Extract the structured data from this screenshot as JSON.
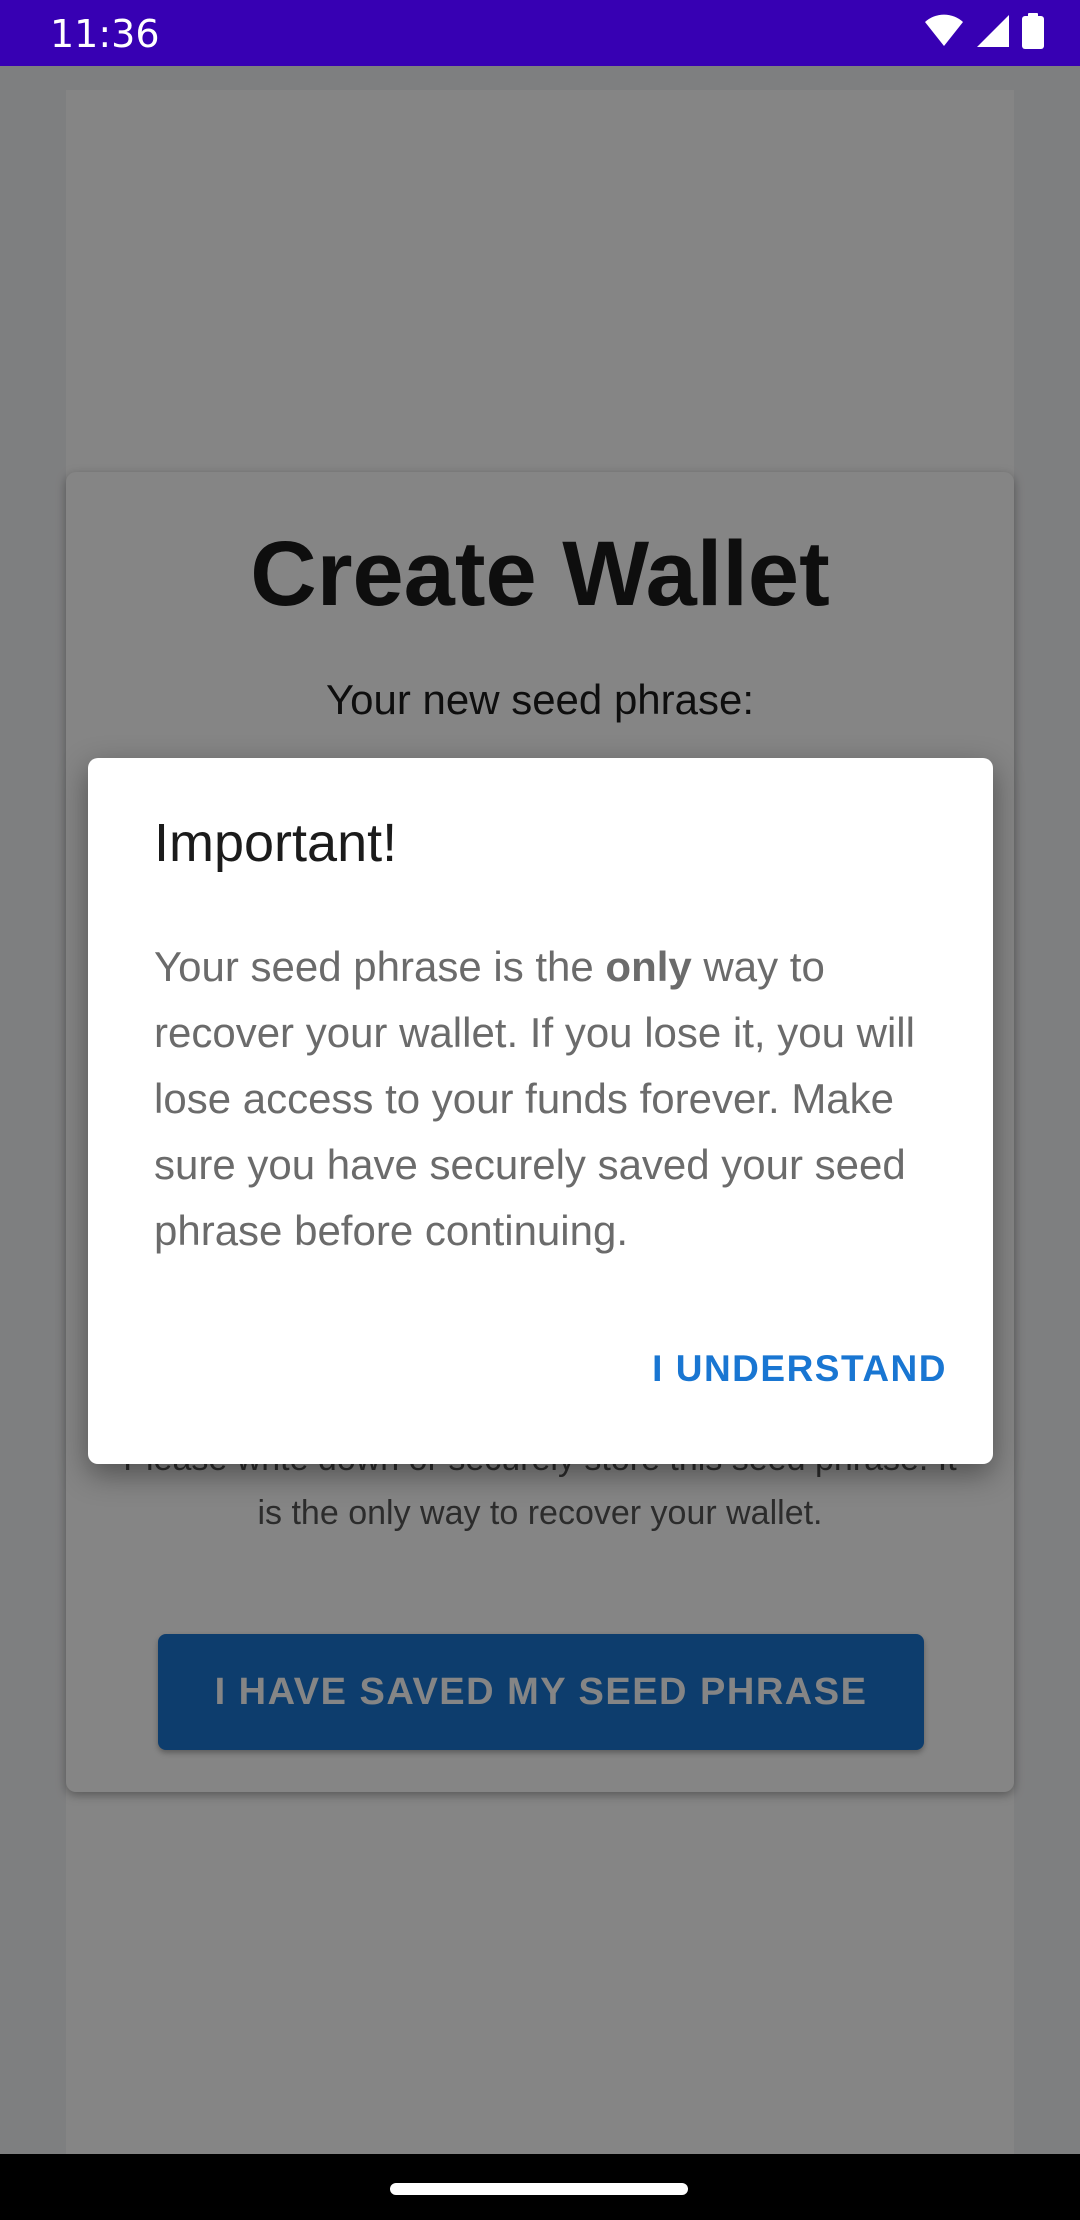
{
  "status_bar": {
    "time": "11:36",
    "icons": [
      "wifi-icon",
      "signal-icon",
      "battery-icon"
    ]
  },
  "card": {
    "title": "Create Wallet",
    "subtitle": "Your new seed phrase:",
    "note": "Please write down or securely store this seed phrase. It is the only way to recover your wallet.",
    "button_label": "I HAVE SAVED MY SEED PHRASE"
  },
  "dialog": {
    "title": "Important!",
    "body_before": "Your seed phrase is the ",
    "body_bold": "only",
    "body_after": " way to recover your wallet. If you lose it, you will lose access to your funds forever. Make sure you have securely saved your seed phrase before continuing.",
    "action_label": "I UNDERSTAND"
  },
  "colors": {
    "status_bar": "#3700b3",
    "accent": "#1976d2",
    "scrim": "rgba(0,0,0,0.48)"
  }
}
